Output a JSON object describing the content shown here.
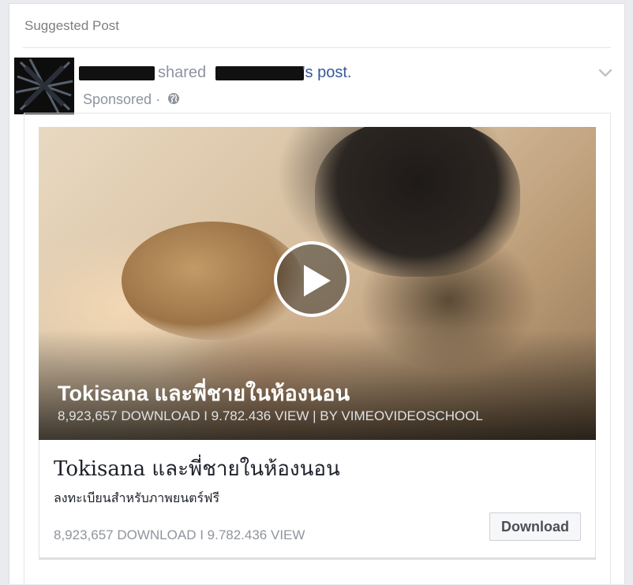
{
  "feed": {
    "section_label": "Suggested Post",
    "header": {
      "shared_text": "shared",
      "post_suffix": "'s post.",
      "sponsored_label": "Sponsored",
      "dot": "·"
    }
  },
  "video": {
    "title": "Tokisana และพี่ชายในห้องนอน",
    "stats": "8,923,657 DOWNLOAD I 9.782.436 VIEW  |  BY VIMEOVIDEOSCHOOL"
  },
  "link": {
    "title": "Tokisana และพี่ชายในห้องนอน",
    "subtitle": "ลงทะเบียนสำหรับภาพยนตร์ฟรี",
    "stats": "8,923,657 DOWNLOAD I 9.782.436 VIEW",
    "button_label": "Download"
  },
  "icons": {
    "globe": "globe-icon",
    "chevron": "chevron-down-icon",
    "play": "play-icon"
  },
  "colors": {
    "link": "#365899",
    "muted": "#8d949e",
    "background": "#e9ebee"
  }
}
